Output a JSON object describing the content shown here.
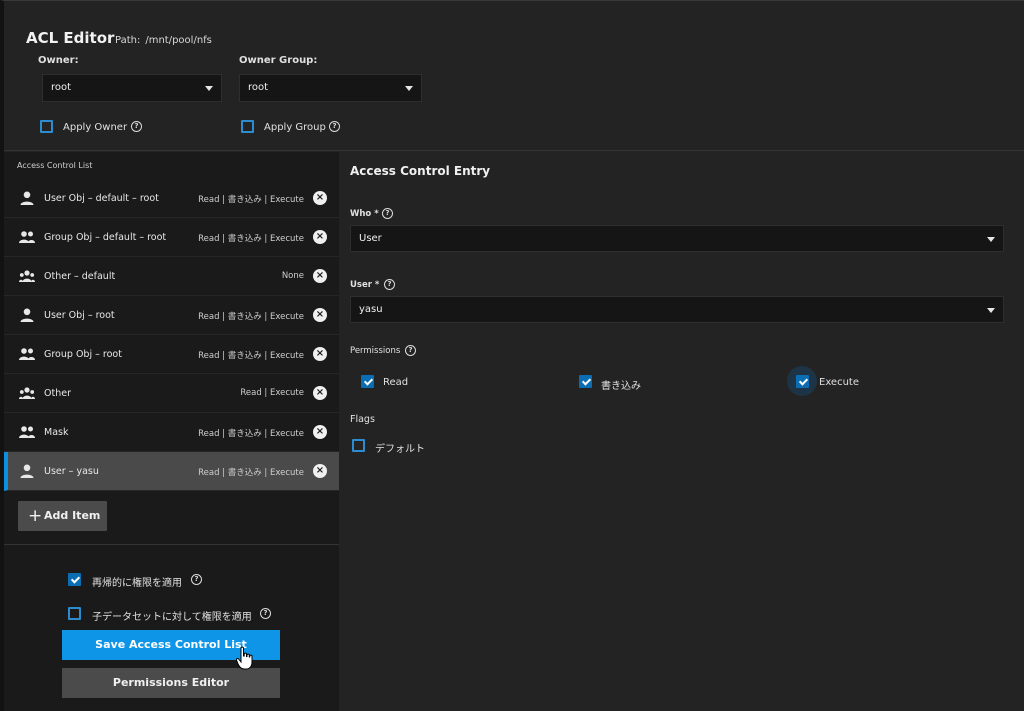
{
  "header": {
    "title": "ACL Editor",
    "path_label": "Path:",
    "path_value": "/mnt/pool/nfs",
    "owner_label": "Owner:",
    "owner_value": "root",
    "owner_group_label": "Owner Group:",
    "owner_group_value": "root",
    "apply_owner_label": "Apply Owner",
    "apply_group_label": "Apply Group"
  },
  "acl": {
    "title": "Access Control List",
    "items": [
      {
        "icon": "user-icon",
        "name": "User Obj – default – root",
        "perms": "Read | 書き込み | Execute"
      },
      {
        "icon": "group-icon",
        "name": "Group Obj – default – root",
        "perms": "Read | 書き込み | Execute"
      },
      {
        "icon": "everyone-icon",
        "name": "Other – default",
        "perms": "None"
      },
      {
        "icon": "user-icon",
        "name": "User Obj – root",
        "perms": "Read | 書き込み | Execute"
      },
      {
        "icon": "group-icon",
        "name": "Group Obj – root",
        "perms": "Read | 書き込み | Execute"
      },
      {
        "icon": "everyone-icon",
        "name": "Other",
        "perms": "Read | Execute"
      },
      {
        "icon": "group-icon",
        "name": "Mask",
        "perms": "Read | 書き込み | Execute"
      },
      {
        "icon": "user-icon",
        "name": "User – yasu",
        "perms": "Read | 書き込み | Execute"
      }
    ],
    "add_item_label": "Add Item",
    "recursive_label": "再帰的に権限を適用",
    "child_datasets_label": "子データセットに対して権限を適用",
    "save_label": "Save Access Control List",
    "permissions_editor_label": "Permissions Editor"
  },
  "entry": {
    "title": "Access Control Entry",
    "who_label": "Who *",
    "who_value": "User",
    "user_label": "User *",
    "user_value": "yasu",
    "permissions_label": "Permissions",
    "perm_read": "Read",
    "perm_write": "書き込み",
    "perm_execute": "Execute",
    "flags_label": "Flags",
    "flag_default": "デフォルト"
  },
  "colors": {
    "accent": "#0e95e8",
    "checkbox": "#0b6eb3",
    "selected_bg": "#4a4a4a"
  }
}
